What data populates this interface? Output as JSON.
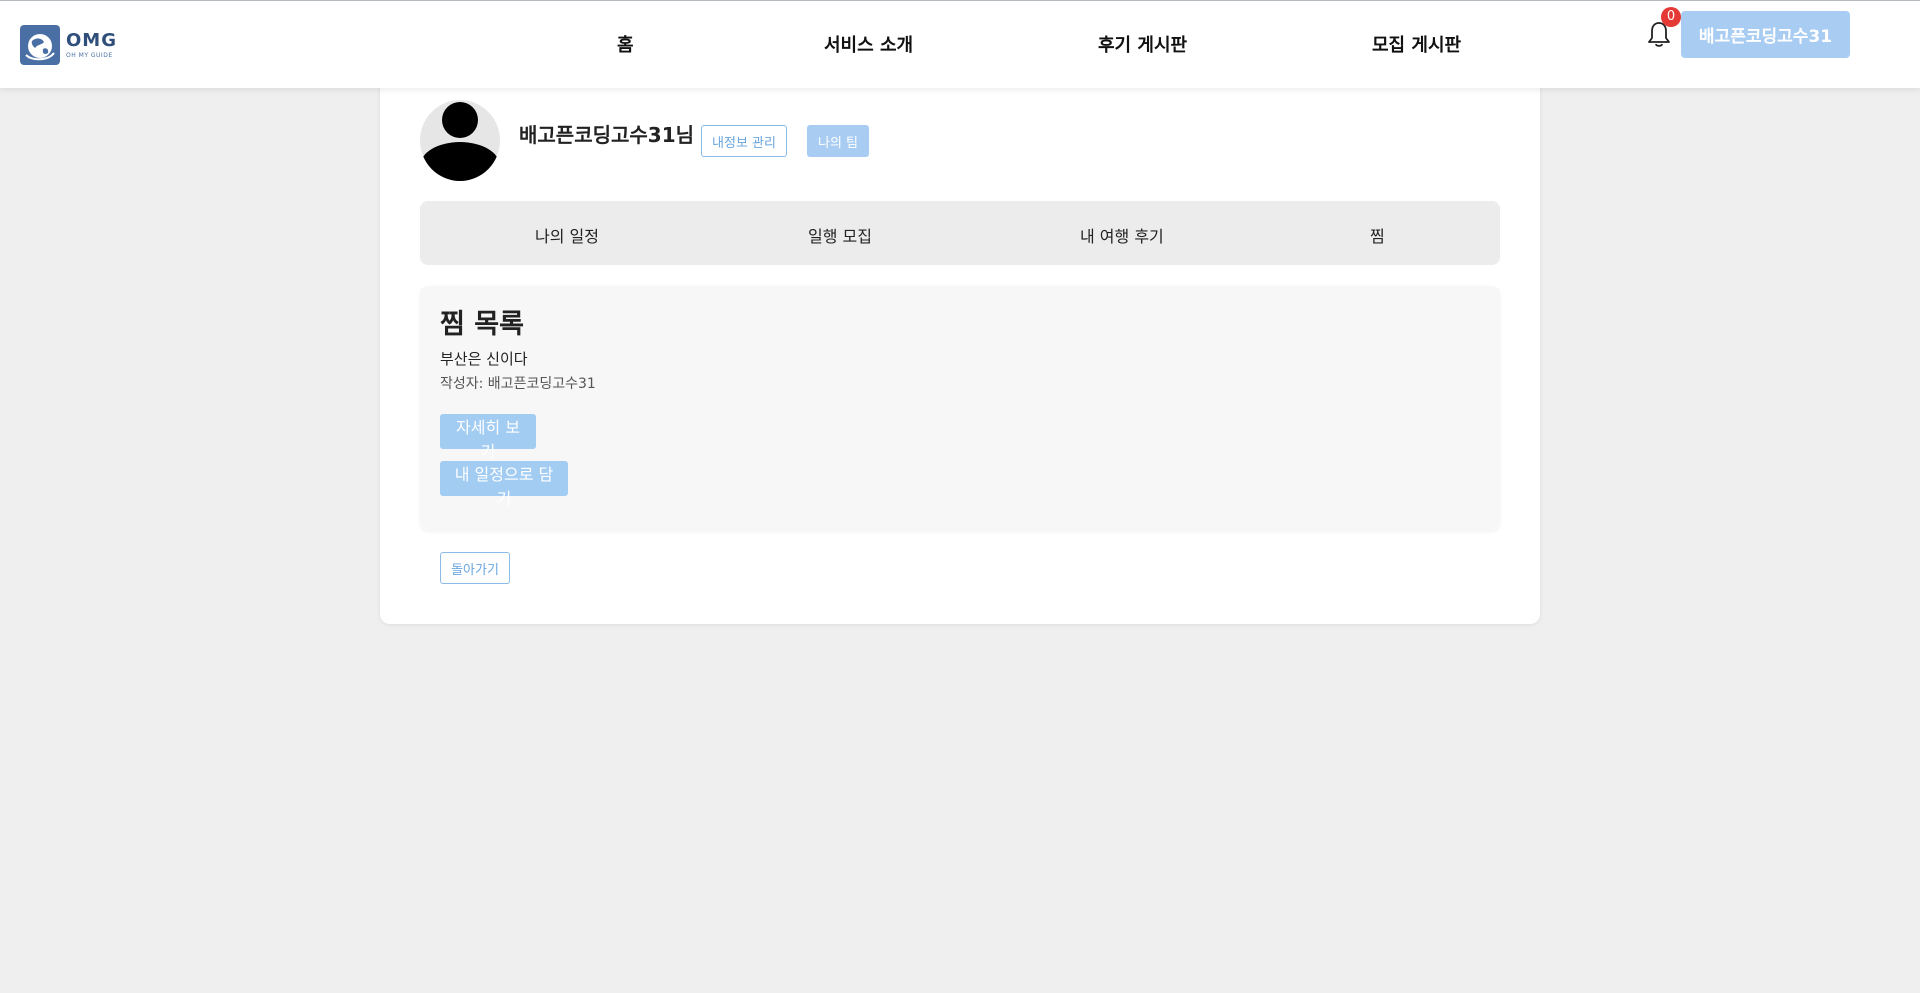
{
  "header": {
    "logo": {
      "title": "OMG",
      "subtitle": "OH MY GUIDE",
      "icon": "globe-logo-icon"
    },
    "nav": [
      {
        "label": "홈"
      },
      {
        "label": "서비스 소개"
      },
      {
        "label": "후기 게시판"
      },
      {
        "label": "모집 게시판"
      }
    ],
    "notification": {
      "icon": "bell-icon",
      "count": "0"
    },
    "user_button": "배고픈코딩고수31"
  },
  "profile": {
    "avatar_icon": "user-avatar-icon",
    "name": "배고픈코딩고수31님",
    "manage_button": "내정보 관리",
    "team_button": "나의 팀"
  },
  "tabs": [
    {
      "label": "나의 일정"
    },
    {
      "label": "일행 모집"
    },
    {
      "label": "내 여행 후기"
    },
    {
      "label": "찜"
    }
  ],
  "wishlist": {
    "title": "찜 목록",
    "items": [
      {
        "title": "부산은 신이다",
        "author": "작성자: 배고픈코딩고수31",
        "detail_button": "자세히 보기",
        "add_button": "내 일정으로 담기"
      }
    ]
  },
  "back_button": "돌아가기",
  "colors": {
    "accent": "#a9cdf2",
    "accent_text": "#6aa6de",
    "badge": "#e53935",
    "background": "#efefef"
  }
}
